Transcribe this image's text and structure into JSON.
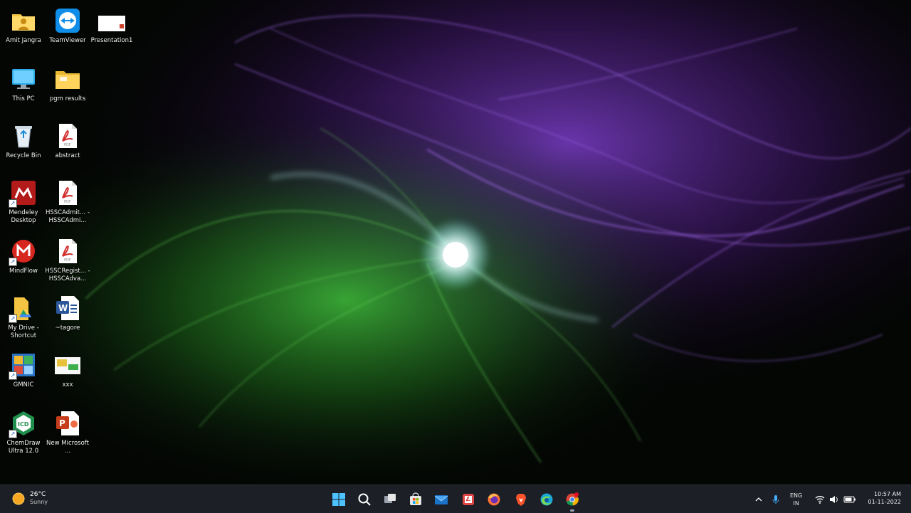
{
  "desktop": {
    "icons": [
      {
        "label": "Amit Jangra",
        "icon": "user-folder-icon"
      },
      {
        "label": "TeamViewer",
        "icon": "teamviewer-icon"
      },
      {
        "label": "Presentation1",
        "icon": "presentation-file-icon"
      },
      {
        "label": "This PC",
        "icon": "monitor-icon"
      },
      {
        "label": "pgm results",
        "icon": "folder-icon"
      },
      {
        "label": "Recycle Bin",
        "icon": "recycle-bin-icon"
      },
      {
        "label": "abstract",
        "icon": "pdf-file-icon"
      },
      {
        "label": "Mendeley Desktop",
        "icon": "mendeley-icon"
      },
      {
        "label": "HSSCAdmit... - HSSCAdmi...",
        "icon": "pdf-file-icon"
      },
      {
        "label": "MindFlow",
        "icon": "mindflow-icon"
      },
      {
        "label": "HSSCRegist... - HSSCAdva...",
        "icon": "pdf-file-icon"
      },
      {
        "label": "My Drive - Shortcut",
        "icon": "google-drive-icon"
      },
      {
        "label": "~tagore",
        "icon": "word-file-icon"
      },
      {
        "label": "GMNIC",
        "icon": "gmnic-icon"
      },
      {
        "label": "xxx",
        "icon": "image-file-icon"
      },
      {
        "label": "ChemDraw Ultra 12.0",
        "icon": "chemdraw-icon"
      },
      {
        "label": "New Microsoft ...",
        "icon": "powerpoint-file-icon"
      }
    ]
  },
  "taskbar": {
    "weather": {
      "temp": "26°C",
      "condition": "Sunny"
    },
    "apps": [
      {
        "name": "start-button",
        "icon": "windows-logo-icon"
      },
      {
        "name": "search-button",
        "icon": "search-icon"
      },
      {
        "name": "task-view-button",
        "icon": "task-view-icon"
      },
      {
        "name": "microsoft-store-button",
        "icon": "store-icon"
      },
      {
        "name": "mail-button",
        "icon": "mail-icon"
      },
      {
        "name": "pdf-reader-button",
        "icon": "pdf-app-icon"
      },
      {
        "name": "firefox-button",
        "icon": "firefox-icon"
      },
      {
        "name": "brave-button",
        "icon": "brave-icon"
      },
      {
        "name": "edge-button",
        "icon": "edge-icon"
      },
      {
        "name": "chrome-button",
        "icon": "chrome-icon"
      }
    ],
    "tray": {
      "language": "ENG",
      "region": "IN",
      "time": "10:57 AM",
      "date": "01-11-2022"
    }
  },
  "colors": {
    "taskbar": "#1c1f26",
    "accent_purple": "#9b4dff",
    "accent_green": "#3fbf3a"
  }
}
